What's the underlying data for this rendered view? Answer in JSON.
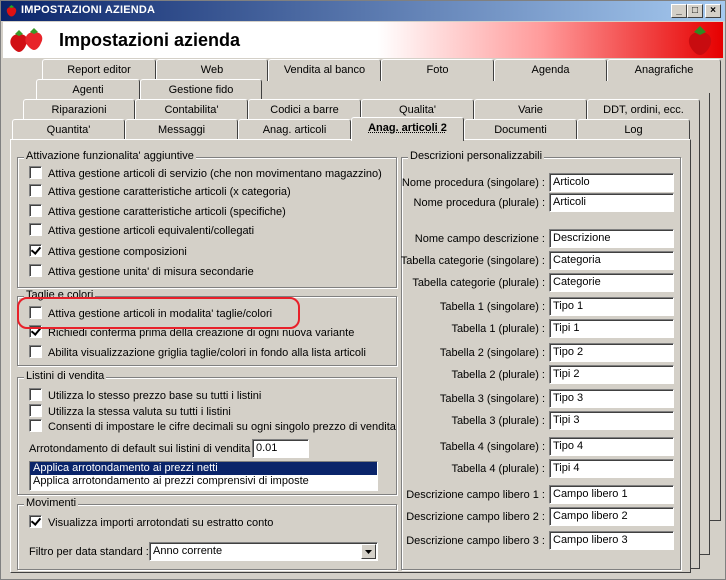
{
  "window": {
    "title": "IMPOSTAZIONI AZIENDA",
    "minimize": "_",
    "maximize": "□",
    "close": "×"
  },
  "banner": {
    "title": "Impostazioni azienda"
  },
  "tabs": {
    "row1": [
      "Report editor",
      "Web",
      "Vendita al banco",
      "Foto",
      "Agenda",
      "Anagrafiche"
    ],
    "row2": [
      "Agenti",
      "Gestione fido"
    ],
    "row3": [
      "Riparazioni",
      "Contabilita'",
      "Codici a barre",
      "Qualita'",
      "Varie",
      "DDT, ordini, ecc."
    ],
    "row4": [
      "Quantita'",
      "Messaggi",
      "Anag. articoli",
      "Anag. articoli 2",
      "Documenti",
      "Log"
    ]
  },
  "funzionalita": {
    "title": "Attivazione funzionalita' aggiuntive",
    "items": [
      {
        "label": "Attiva gestione articoli di servizio (che non movimentano magazzino)",
        "checked": false
      },
      {
        "label": "Attiva gestione caratteristiche articoli (x categoria)",
        "checked": false
      },
      {
        "label": "Attiva gestione caratteristiche articoli (specifiche)",
        "checked": false
      },
      {
        "label": "Attiva gestione articoli equivalenti/collegati",
        "checked": false
      },
      {
        "label": "Attiva gestione composizioni",
        "checked": true
      },
      {
        "label": "Attiva gestione unita' di misura secondarie",
        "checked": false
      }
    ]
  },
  "taglie": {
    "title": "Taglie e colori",
    "items": [
      {
        "label": "Attiva gestione articoli in modalita' taglie/colori",
        "checked": false
      },
      {
        "label": "Richiedi conferma prima della creazione di ogni nuova variante",
        "checked": true
      },
      {
        "label": "Abilita visualizzazione griglia taglie/colori in fondo alla lista articoli",
        "checked": false
      }
    ]
  },
  "listini": {
    "title": "Listini di vendita",
    "items": [
      {
        "label": "Utilizza lo stesso prezzo base su tutti i listini",
        "checked": false
      },
      {
        "label": "Utilizza la stessa valuta su tutti i listini",
        "checked": false
      },
      {
        "label": "Consenti di impostare le cifre decimali su ogni singolo prezzo di vendita",
        "checked": false
      }
    ],
    "arrotondamento_label": "Arrotondamento di default sui listini di vendita :",
    "arrotondamento_value": "0.01",
    "options": [
      "Applica arrotondamento ai prezzi netti",
      "Applica arrotondamento ai prezzi comprensivi di imposte"
    ],
    "selected_option": 0
  },
  "movimenti": {
    "title": "Movimenti",
    "items": [
      {
        "label": "Visualizza importi arrotondati su estratto conto",
        "checked": true
      }
    ],
    "filtro_label": "Filtro per data standard :",
    "filtro_value": "Anno corrente"
  },
  "descrizioni": {
    "title": "Descrizioni personalizzabili",
    "fields": [
      {
        "label": "Nome procedura (singolare) :",
        "value": "Articolo"
      },
      {
        "label": "Nome procedura (plurale) :",
        "value": "Articoli"
      },
      {
        "label": "Nome campo descrizione :",
        "value": "Descrizione"
      },
      {
        "label": "Tabella categorie (singolare) :",
        "value": "Categoria"
      },
      {
        "label": "Tabella categorie (plurale) :",
        "value": "Categorie"
      },
      {
        "label": "Tabella 1 (singolare) :",
        "value": "Tipo 1"
      },
      {
        "label": "Tabella 1 (plurale) :",
        "value": "Tipi 1"
      },
      {
        "label": "Tabella 2 (singolare) :",
        "value": "Tipo 2"
      },
      {
        "label": "Tabella 2 (plurale) :",
        "value": "Tipi 2"
      },
      {
        "label": "Tabella 3 (singolare) :",
        "value": "Tipo 3"
      },
      {
        "label": "Tabella 3 (plurale) :",
        "value": "Tipi 3"
      },
      {
        "label": "Tabella 4 (singolare) :",
        "value": "Tipo 4"
      },
      {
        "label": "Tabella 4 (plurale) :",
        "value": "Tipi 4"
      },
      {
        "label": "Descrizione campo libero 1 :",
        "value": "Campo libero 1"
      },
      {
        "label": "Descrizione campo libero 2 :",
        "value": "Campo libero 2"
      },
      {
        "label": "Descrizione campo libero 3 :",
        "value": "Campo libero 3"
      }
    ]
  },
  "colors": {
    "titlebar": "#0a246a",
    "highlight": "#e8202a",
    "selection": "#0a246a"
  }
}
